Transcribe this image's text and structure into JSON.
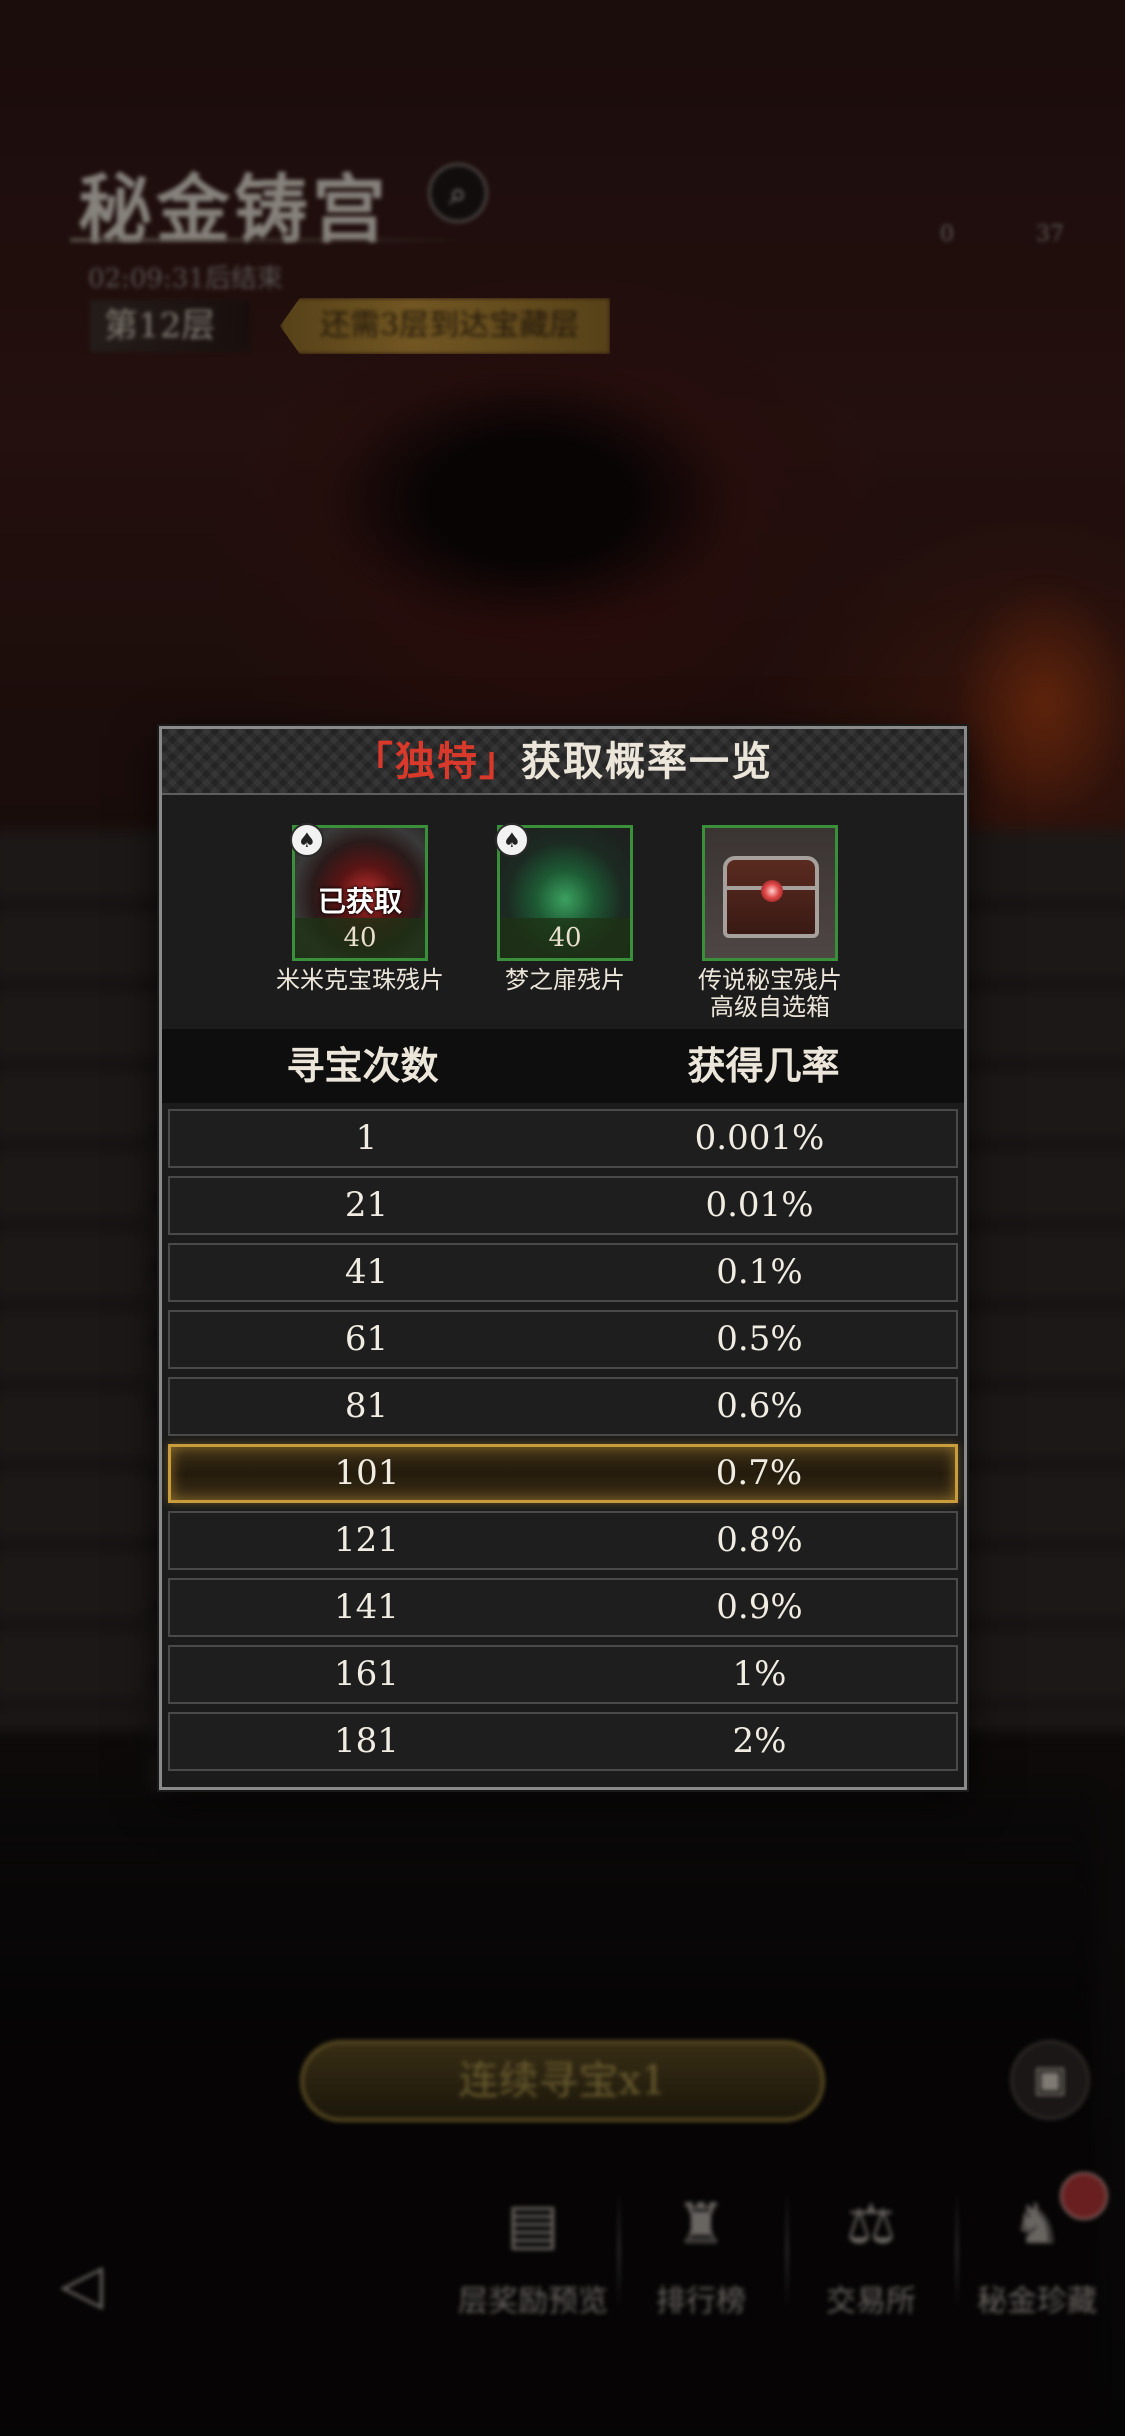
{
  "background": {
    "title": "秘金铸宫",
    "timer": "02:09:31后结束",
    "floor_label": "第12层",
    "goal_label": "还需3层到达宝藏层",
    "resources": [
      "0",
      "37"
    ],
    "continue_button": "连续寻宝x1",
    "nav": [
      {
        "label": "层奖励预览",
        "icon": "floor-reward-icon"
      },
      {
        "label": "排行榜",
        "icon": "trophy-icon"
      },
      {
        "label": "交易所",
        "icon": "exchange-icon"
      },
      {
        "label": "秘金珍藏",
        "icon": "collection-icon"
      }
    ]
  },
  "modal": {
    "title_prefix": "「独特」",
    "title_rest": "获取概率一览",
    "items": [
      {
        "name": "米米克宝珠残片",
        "count": "40",
        "status": "已获取"
      },
      {
        "name": "梦之扉残片",
        "count": "40",
        "status": ""
      },
      {
        "name": "传说秘宝残片\n高级自选箱",
        "count": "",
        "status": ""
      }
    ],
    "columns": [
      "寻宝次数",
      "获得几率"
    ],
    "rows": [
      {
        "count": "1",
        "rate": "0.001%"
      },
      {
        "count": "21",
        "rate": "0.01%"
      },
      {
        "count": "41",
        "rate": "0.1%"
      },
      {
        "count": "61",
        "rate": "0.5%"
      },
      {
        "count": "81",
        "rate": "0.6%"
      },
      {
        "count": "101",
        "rate": "0.7%"
      },
      {
        "count": "121",
        "rate": "0.8%"
      },
      {
        "count": "141",
        "rate": "0.9%"
      },
      {
        "count": "161",
        "rate": "1%"
      },
      {
        "count": "181",
        "rate": "2%"
      }
    ],
    "highlighted_row_index": 5
  },
  "colors": {
    "accent_red": "#d8392b",
    "highlight_gold": "#c99d3c",
    "item_frame_green": "#3a8f3a"
  }
}
